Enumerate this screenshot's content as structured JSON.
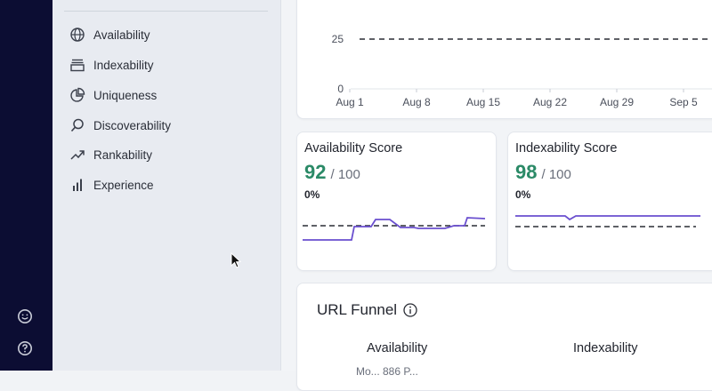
{
  "rail": {
    "icons": [
      "smiley-icon",
      "help-circle-icon"
    ]
  },
  "sidebar": {
    "items": [
      {
        "label": "Availability",
        "icon": "globe-icon"
      },
      {
        "label": "Indexability",
        "icon": "stack-icon"
      },
      {
        "label": "Uniqueness",
        "icon": "pie-chart-icon"
      },
      {
        "label": "Discoverability",
        "icon": "search-icon"
      },
      {
        "label": "Rankability",
        "icon": "trending-up-icon"
      },
      {
        "label": "Experience",
        "icon": "bar-chart-icon"
      }
    ]
  },
  "top_chart": {
    "y_ticks": [
      "25",
      "0"
    ],
    "x_ticks": [
      "Aug 1",
      "Aug 8",
      "Aug 15",
      "Aug 22",
      "Aug 29",
      "Sep 5"
    ]
  },
  "availability_card": {
    "title": "Availability Score",
    "score": "92",
    "max": "/ 100",
    "delta": "0%"
  },
  "indexability_card": {
    "title": "Indexability Score",
    "score": "98",
    "max": "/ 100",
    "delta": "0%"
  },
  "funnel": {
    "title": "URL Funnel",
    "columns": [
      "Availability",
      "Indexability"
    ],
    "truncated_text": "Mo... 886 P..."
  },
  "colors": {
    "accent_green": "#2b8a67",
    "line_purple": "#6a4fcf",
    "rail_navy": "#0c0d33"
  }
}
